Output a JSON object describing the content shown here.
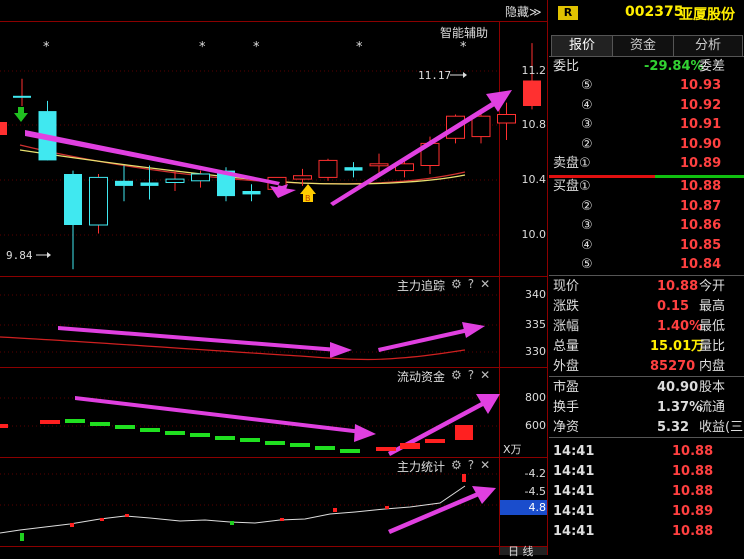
{
  "header": {
    "hide_label": "隐藏≫",
    "badge": "R",
    "code": "002375",
    "name": "亚厦股份"
  },
  "tabs": [
    {
      "label": "报价"
    },
    {
      "label": "资金"
    },
    {
      "label": "分析"
    }
  ],
  "main_panel": {
    "title": "智能辅助",
    "max_label": "11.17",
    "min_label": "9.84",
    "axis": [
      "11.2",
      "10.8",
      "10.4",
      "10.0"
    ],
    "stars": [
      "*",
      "*",
      "*",
      "*",
      "*"
    ],
    "marker": "B"
  },
  "panels": [
    {
      "title": "主力追踪",
      "axis": [
        "340",
        "335",
        "330"
      ]
    },
    {
      "title": "流动资金",
      "axis": [
        "800",
        "600",
        "X万"
      ]
    },
    {
      "title": "主力统计",
      "axis": [
        "-4.2",
        "-4.5",
        "4.8"
      ]
    }
  ],
  "bottom": {
    "label": "日 线"
  },
  "quote": {
    "weibi_label": "委比",
    "weibi_value": "-29.84%",
    "weicha_label": "委差",
    "asks": [
      {
        "level": "⑤",
        "price": "10.93"
      },
      {
        "level": "④",
        "price": "10.92"
      },
      {
        "level": "③",
        "price": "10.91"
      },
      {
        "level": "②",
        "price": "10.90"
      },
      {
        "level": "卖盘①",
        "price": "10.89"
      }
    ],
    "bids": [
      {
        "level": "买盘①",
        "price": "10.88"
      },
      {
        "level": "②",
        "price": "10.87"
      },
      {
        "level": "③",
        "price": "10.86"
      },
      {
        "level": "④",
        "price": "10.85"
      },
      {
        "level": "⑤",
        "price": "10.84"
      }
    ],
    "stats": [
      {
        "label": "现价",
        "value": "10.88",
        "label2": "今开"
      },
      {
        "label": "涨跌",
        "value": "0.15",
        "label2": "最高"
      },
      {
        "label": "涨幅",
        "value": "1.40%",
        "label2": "最低"
      },
      {
        "label": "总量",
        "value": "15.01万",
        "label2": "量比"
      },
      {
        "label": "外盘",
        "value": "85270",
        "label2": "内盘"
      },
      {
        "label": "市盈",
        "value": "40.90",
        "label2": "股本"
      },
      {
        "label": "换手",
        "value": "1.37%",
        "label2": "流通"
      },
      {
        "label": "净资",
        "value": "5.32",
        "label2": "收益(三"
      }
    ],
    "trades": [
      {
        "time": "14:41",
        "price": "10.88"
      },
      {
        "time": "14:41",
        "price": "10.88"
      },
      {
        "time": "14:41",
        "price": "10.88"
      },
      {
        "time": "14:41",
        "price": "10.89"
      },
      {
        "time": "14:41",
        "price": "10.88"
      }
    ]
  },
  "chart_data": {
    "type": "candlestick",
    "ylim": [
      9.8,
      11.3
    ],
    "candles": [
      {
        "o": 10.86,
        "h": 10.96,
        "l": 10.8,
        "c": 10.85,
        "dir": "up"
      },
      {
        "o": 10.77,
        "h": 10.83,
        "l": 10.48,
        "c": 10.48,
        "dir": "down"
      },
      {
        "o": 10.4,
        "h": 10.42,
        "l": 9.84,
        "c": 10.1,
        "dir": "down"
      },
      {
        "o": 10.1,
        "h": 10.4,
        "l": 10.05,
        "c": 10.38,
        "dir": "up"
      },
      {
        "o": 10.36,
        "h": 10.45,
        "l": 10.24,
        "c": 10.33,
        "dir": "down"
      },
      {
        "o": 10.35,
        "h": 10.45,
        "l": 10.25,
        "c": 10.33,
        "dir": "down"
      },
      {
        "o": 10.35,
        "h": 10.42,
        "l": 10.3,
        "c": 10.37,
        "dir": "up"
      },
      {
        "o": 10.36,
        "h": 10.42,
        "l": 10.32,
        "c": 10.4,
        "dir": "up"
      },
      {
        "o": 10.42,
        "h": 10.44,
        "l": 10.24,
        "c": 10.27,
        "dir": "down"
      },
      {
        "o": 10.3,
        "h": 10.34,
        "l": 10.24,
        "c": 10.28,
        "dir": "down"
      },
      {
        "o": 10.31,
        "h": 10.38,
        "l": 10.28,
        "c": 10.38,
        "dir": "up"
      },
      {
        "o": 10.37,
        "h": 10.43,
        "l": 10.33,
        "c": 10.39,
        "dir": "up"
      },
      {
        "o": 10.38,
        "h": 10.49,
        "l": 10.36,
        "c": 10.48,
        "dir": "up"
      },
      {
        "o": 10.44,
        "h": 10.47,
        "l": 10.38,
        "c": 10.42,
        "dir": "down"
      },
      {
        "o": 10.45,
        "h": 10.52,
        "l": 10.39,
        "c": 10.46,
        "dir": "up"
      },
      {
        "o": 10.42,
        "h": 10.49,
        "l": 10.38,
        "c": 10.46,
        "dir": "up"
      },
      {
        "o": 10.45,
        "h": 10.62,
        "l": 10.4,
        "c": 10.58,
        "dir": "up"
      },
      {
        "o": 10.61,
        "h": 10.75,
        "l": 10.58,
        "c": 10.74,
        "dir": "up"
      },
      {
        "o": 10.62,
        "h": 10.76,
        "l": 10.58,
        "c": 10.74,
        "dir": "up"
      },
      {
        "o": 10.7,
        "h": 10.82,
        "l": 10.6,
        "c": 10.75,
        "dir": "up"
      },
      {
        "o": 10.8,
        "h": 11.17,
        "l": 10.78,
        "c": 10.95,
        "dir": "up"
      }
    ]
  }
}
